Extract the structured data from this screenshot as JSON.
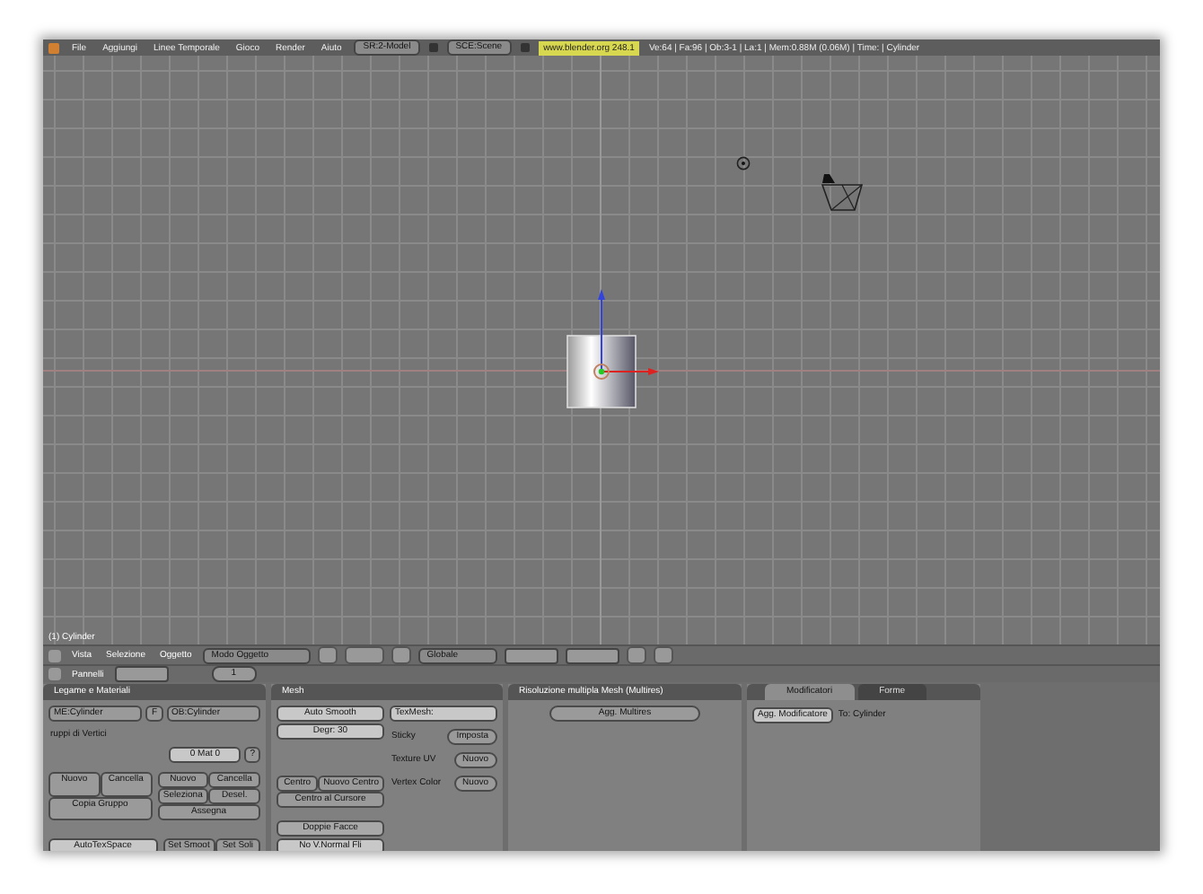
{
  "menubar": {
    "menus": [
      "File",
      "Aggiungi",
      "Linee Temporale",
      "Gioco",
      "Render",
      "Aiuto"
    ],
    "screen": "SR:2-Model",
    "scene": "SCE:Scene",
    "version": "www.blender.org 248.1",
    "stats": "Ve:64 | Fa:96 | Ob:3-1 | La:1 | Mem:0.88M (0.06M) | Time: | Cylinder"
  },
  "viewport": {
    "object_label": "(1) Cylinder"
  },
  "header": {
    "menus": [
      "Vista",
      "Selezione",
      "Oggetto"
    ],
    "mode": "Modo Oggetto",
    "orientation": "Globale"
  },
  "buttons_header": {
    "label": "Pannelli",
    "value": "1"
  },
  "links_panel": {
    "title": "Legame e Materiali",
    "mesh": "ME:Cylinder",
    "fake": "F",
    "object": "OB:Cylinder",
    "groups_label": "ruppi di Vertici",
    "material": "0 Mat 0",
    "material_help": "?",
    "group_buttons": [
      "Nuovo",
      "Cancella",
      "Copia Gruppo"
    ],
    "vertex_buttons": [
      "Nuovo",
      "Cancella",
      "Seleziona",
      "Desel.",
      "Assegna"
    ],
    "autotex": "AutoTexSpace",
    "set_smooth": "Set Smoot",
    "set_solid": "Set Soli"
  },
  "mesh_panel": {
    "title": "Mesh",
    "auto_smooth": "Auto Smooth",
    "degrees": "Degr: 30",
    "texmesh": "TexMesh:",
    "rows": [
      {
        "label": "Sticky",
        "button": "Imposta"
      },
      {
        "label": "Texture UV",
        "button": "Nuovo"
      },
      {
        "label": "Vertex Color",
        "button": "Nuovo"
      }
    ],
    "centre": "Centro",
    "new_centre": "Nuovo Centro",
    "centre_cursor": "Centro al Cursore",
    "double_sided": "Doppie Facce",
    "no_flip": "No V.Normal Fli"
  },
  "multires_panel": {
    "title": "Risoluzione multipla Mesh (Multires)",
    "button": "Agg. Multires"
  },
  "modifiers_panel": {
    "tabs": [
      {
        "label": "Modificatori",
        "selected": true
      },
      {
        "label": "Forme",
        "selected": false
      }
    ],
    "add": "Agg. Modificatore",
    "target": "To: Cylinder"
  }
}
